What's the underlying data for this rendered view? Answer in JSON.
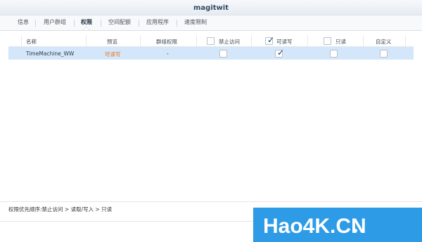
{
  "window": {
    "title": "magitwit"
  },
  "tabs": [
    {
      "label": "信息"
    },
    {
      "label": "用户群组"
    },
    {
      "label": "权限",
      "active": true
    },
    {
      "label": "空间配额"
    },
    {
      "label": "应用程序"
    },
    {
      "label": "速度限制"
    }
  ],
  "table": {
    "columns": {
      "name": "名称",
      "preview": "预览",
      "group_perm": "群组权限",
      "deny": "禁止访问",
      "rw": "可读写",
      "ro": "只读",
      "custom": "自定义"
    },
    "header_checks": {
      "deny": false,
      "rw": true,
      "ro": false
    },
    "rows": [
      {
        "name": "TimeMachine_WW",
        "preview": "可读写",
        "group_perm": "-",
        "deny": false,
        "rw": true,
        "ro": false,
        "custom": false
      }
    ]
  },
  "footer": {
    "text": "权限优先顺序:禁止访问 > 读取/写入 > 只读"
  },
  "watermark": {
    "text": "Hao4K.CN"
  },
  "colors": {
    "preview_orange": "#e8731a",
    "selected_row": "#d4e6f9",
    "watermark_bg": "#2d9be6"
  }
}
